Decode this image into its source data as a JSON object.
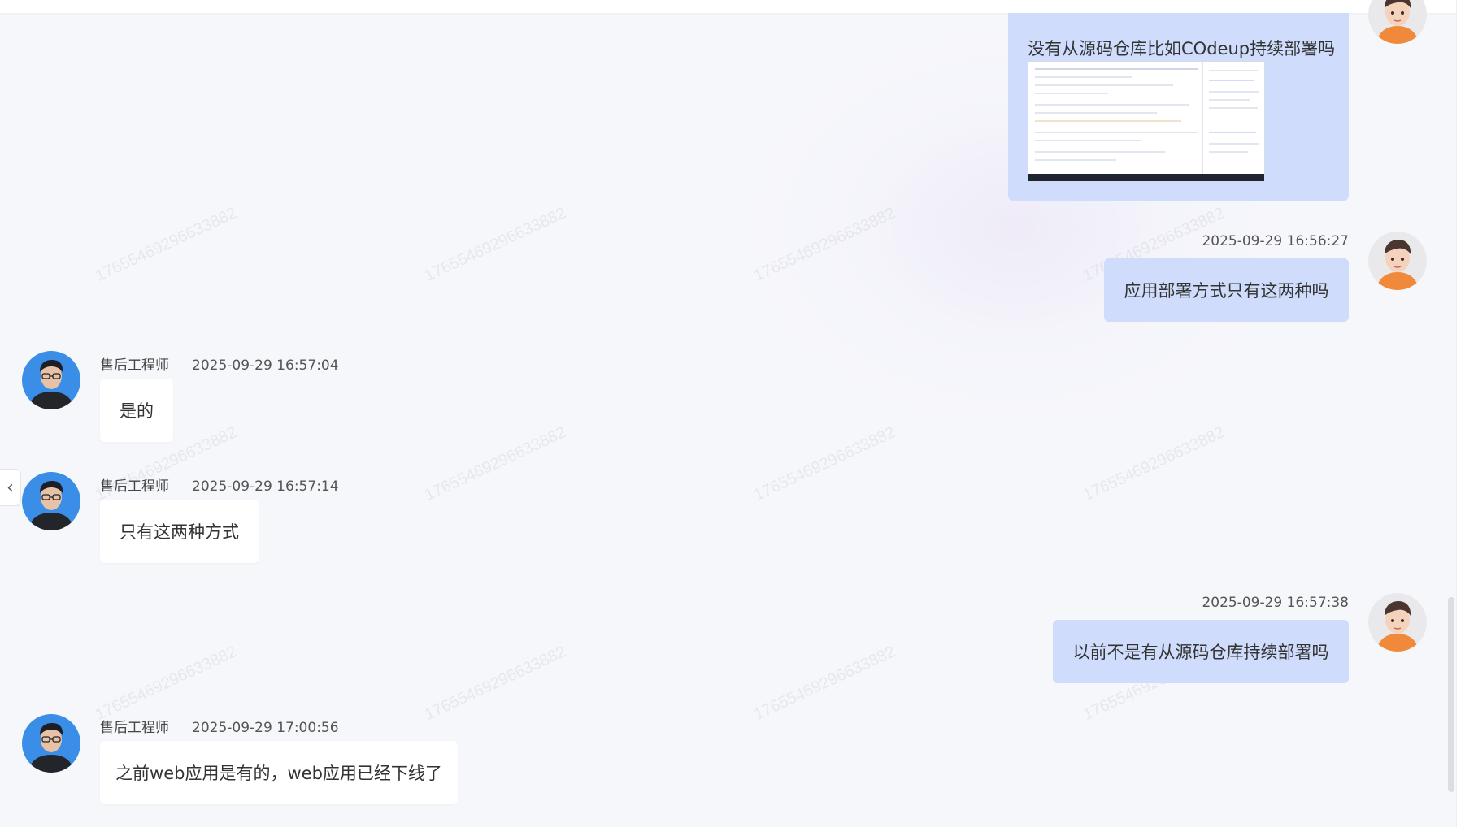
{
  "watermark_text": "17655469296633882",
  "messages": [
    {
      "role": "user",
      "text": "没有从源码仓库比如COdeup持续部署吗",
      "has_image": true
    },
    {
      "role": "user",
      "time": "2025-09-29 16:56:27",
      "text": "应用部署方式只有这两种吗"
    },
    {
      "role": "agent",
      "name": "售后工程师",
      "time": "2025-09-29 16:57:04",
      "text": "是的"
    },
    {
      "role": "agent",
      "name": "售后工程师",
      "time": "2025-09-29 16:57:14",
      "text": "只有这两种方式"
    },
    {
      "role": "user",
      "time": "2025-09-29 16:57:38",
      "text": "以前不是有从源码仓库持续部署吗"
    },
    {
      "role": "agent",
      "name": "售后工程师",
      "time": "2025-09-29 17:00:56",
      "text": "之前web应用是有的，web应用已经下线了"
    }
  ],
  "icons": {
    "side_toggle": "chevron-left-icon",
    "user_avatar": "user-avatar-icon",
    "agent_avatar": "agent-avatar-icon"
  },
  "colors": {
    "user_bubble": "#cfdcfb",
    "agent_bubble": "#ffffff",
    "background": "#f6f7fb"
  }
}
